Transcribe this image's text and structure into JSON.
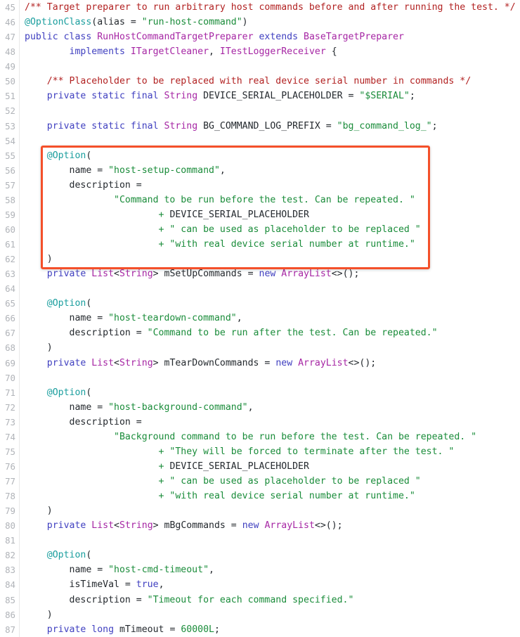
{
  "view": {
    "kind": "source-code-viewer",
    "language": "Java",
    "first_line_number": 45,
    "background_color": "#ffffff",
    "gutter_color": "#b0b3b8"
  },
  "highlight": {
    "label": "annotation-highlight-box",
    "color": "#f4502a",
    "covers_lines": "55-62"
  },
  "palette": {
    "comment": "#b22222",
    "annotation": "#1a9e9e",
    "keyword": "#4040c0",
    "type": "#a626a4",
    "string": "#1a8c3a",
    "number": "#1a8c3a",
    "plain": "#24292e"
  },
  "lines": [
    {
      "n": "45",
      "tokens": [
        {
          "t": "comment",
          "s": "/** Target preparer to run arbitrary host commands before and after running the test. */"
        }
      ]
    },
    {
      "n": "46",
      "tokens": [
        {
          "t": "anno",
          "s": "@OptionClass"
        },
        {
          "t": "plain",
          "s": "(alias = "
        },
        {
          "t": "str",
          "s": "\"run-host-command\""
        },
        {
          "t": "plain",
          "s": ")"
        }
      ]
    },
    {
      "n": "47",
      "tokens": [
        {
          "t": "kw",
          "s": "public class "
        },
        {
          "t": "type",
          "s": "RunHostCommandTargetPreparer"
        },
        {
          "t": "kw",
          "s": " extends "
        },
        {
          "t": "type",
          "s": "BaseTargetPreparer"
        }
      ]
    },
    {
      "n": "48",
      "tokens": [
        {
          "t": "kw",
          "s": "        implements "
        },
        {
          "t": "type",
          "s": "ITargetCleaner"
        },
        {
          "t": "plain",
          "s": ", "
        },
        {
          "t": "type",
          "s": "ITestLoggerReceiver"
        },
        {
          "t": "plain",
          "s": " {"
        }
      ]
    },
    {
      "n": "49",
      "tokens": []
    },
    {
      "n": "50",
      "tokens": [
        {
          "t": "comment",
          "s": "    /** Placeholder to be replaced with real device serial number in commands */"
        }
      ]
    },
    {
      "n": "51",
      "tokens": [
        {
          "t": "kw",
          "s": "    private static final "
        },
        {
          "t": "type",
          "s": "String"
        },
        {
          "t": "plain",
          "s": " DEVICE_SERIAL_PLACEHOLDER = "
        },
        {
          "t": "str",
          "s": "\"$SERIAL\""
        },
        {
          "t": "plain",
          "s": ";"
        }
      ]
    },
    {
      "n": "52",
      "tokens": []
    },
    {
      "n": "53",
      "tokens": [
        {
          "t": "kw",
          "s": "    private static final "
        },
        {
          "t": "type",
          "s": "String"
        },
        {
          "t": "plain",
          "s": " BG_COMMAND_LOG_PREFIX = "
        },
        {
          "t": "str",
          "s": "\"bg_command_log_\""
        },
        {
          "t": "plain",
          "s": ";"
        }
      ]
    },
    {
      "n": "54",
      "tokens": []
    },
    {
      "n": "55",
      "tokens": [
        {
          "t": "plain",
          "s": "    "
        },
        {
          "t": "anno",
          "s": "@Option"
        },
        {
          "t": "plain",
          "s": "("
        }
      ]
    },
    {
      "n": "56",
      "tokens": [
        {
          "t": "plain",
          "s": "        name = "
        },
        {
          "t": "str",
          "s": "\"host-setup-command\""
        },
        {
          "t": "plain",
          "s": ","
        }
      ]
    },
    {
      "n": "57",
      "tokens": [
        {
          "t": "plain",
          "s": "        description ="
        }
      ]
    },
    {
      "n": "58",
      "tokens": [
        {
          "t": "str",
          "s": "                \"Command to be run before the test. Can be repeated. \""
        }
      ]
    },
    {
      "n": "59",
      "tokens": [
        {
          "t": "str",
          "s": "                        + "
        },
        {
          "t": "plain",
          "s": "DEVICE_SERIAL_PLACEHOLDER"
        }
      ]
    },
    {
      "n": "60",
      "tokens": [
        {
          "t": "str",
          "s": "                        + \" can be used as placeholder to be replaced \""
        }
      ]
    },
    {
      "n": "61",
      "tokens": [
        {
          "t": "str",
          "s": "                        + \"with real device serial number at runtime.\""
        }
      ]
    },
    {
      "n": "62",
      "tokens": [
        {
          "t": "plain",
          "s": "    )"
        }
      ]
    },
    {
      "n": "63",
      "tokens": [
        {
          "t": "kw",
          "s": "    private "
        },
        {
          "t": "type",
          "s": "List"
        },
        {
          "t": "plain",
          "s": "<"
        },
        {
          "t": "type",
          "s": "String"
        },
        {
          "t": "plain",
          "s": "> mSetUpCommands = "
        },
        {
          "t": "kw",
          "s": "new "
        },
        {
          "t": "type",
          "s": "ArrayList"
        },
        {
          "t": "plain",
          "s": "<>();"
        }
      ]
    },
    {
      "n": "64",
      "tokens": []
    },
    {
      "n": "65",
      "tokens": [
        {
          "t": "plain",
          "s": "    "
        },
        {
          "t": "anno",
          "s": "@Option"
        },
        {
          "t": "plain",
          "s": "("
        }
      ]
    },
    {
      "n": "66",
      "tokens": [
        {
          "t": "plain",
          "s": "        name = "
        },
        {
          "t": "str",
          "s": "\"host-teardown-command\""
        },
        {
          "t": "plain",
          "s": ","
        }
      ]
    },
    {
      "n": "67",
      "tokens": [
        {
          "t": "plain",
          "s": "        description = "
        },
        {
          "t": "str",
          "s": "\"Command to be run after the test. Can be repeated.\""
        }
      ]
    },
    {
      "n": "68",
      "tokens": [
        {
          "t": "plain",
          "s": "    )"
        }
      ]
    },
    {
      "n": "69",
      "tokens": [
        {
          "t": "kw",
          "s": "    private "
        },
        {
          "t": "type",
          "s": "List"
        },
        {
          "t": "plain",
          "s": "<"
        },
        {
          "t": "type",
          "s": "String"
        },
        {
          "t": "plain",
          "s": "> mTearDownCommands = "
        },
        {
          "t": "kw",
          "s": "new "
        },
        {
          "t": "type",
          "s": "ArrayList"
        },
        {
          "t": "plain",
          "s": "<>();"
        }
      ]
    },
    {
      "n": "70",
      "tokens": []
    },
    {
      "n": "71",
      "tokens": [
        {
          "t": "plain",
          "s": "    "
        },
        {
          "t": "anno",
          "s": "@Option"
        },
        {
          "t": "plain",
          "s": "("
        }
      ]
    },
    {
      "n": "72",
      "tokens": [
        {
          "t": "plain",
          "s": "        name = "
        },
        {
          "t": "str",
          "s": "\"host-background-command\""
        },
        {
          "t": "plain",
          "s": ","
        }
      ]
    },
    {
      "n": "73",
      "tokens": [
        {
          "t": "plain",
          "s": "        description ="
        }
      ]
    },
    {
      "n": "74",
      "tokens": [
        {
          "t": "str",
          "s": "                \"Background command to be run before the test. Can be repeated. \""
        }
      ]
    },
    {
      "n": "75",
      "tokens": [
        {
          "t": "str",
          "s": "                        + \"They will be forced to terminate after the test. \""
        }
      ]
    },
    {
      "n": "76",
      "tokens": [
        {
          "t": "str",
          "s": "                        + "
        },
        {
          "t": "plain",
          "s": "DEVICE_SERIAL_PLACEHOLDER"
        }
      ]
    },
    {
      "n": "77",
      "tokens": [
        {
          "t": "str",
          "s": "                        + \" can be used as placeholder to be replaced \""
        }
      ]
    },
    {
      "n": "78",
      "tokens": [
        {
          "t": "str",
          "s": "                        + \"with real device serial number at runtime.\""
        }
      ]
    },
    {
      "n": "79",
      "tokens": [
        {
          "t": "plain",
          "s": "    )"
        }
      ]
    },
    {
      "n": "80",
      "tokens": [
        {
          "t": "kw",
          "s": "    private "
        },
        {
          "t": "type",
          "s": "List"
        },
        {
          "t": "plain",
          "s": "<"
        },
        {
          "t": "type",
          "s": "String"
        },
        {
          "t": "plain",
          "s": "> mBgCommands = "
        },
        {
          "t": "kw",
          "s": "new "
        },
        {
          "t": "type",
          "s": "ArrayList"
        },
        {
          "t": "plain",
          "s": "<>();"
        }
      ]
    },
    {
      "n": "81",
      "tokens": []
    },
    {
      "n": "82",
      "tokens": [
        {
          "t": "plain",
          "s": "    "
        },
        {
          "t": "anno",
          "s": "@Option"
        },
        {
          "t": "plain",
          "s": "("
        }
      ]
    },
    {
      "n": "83",
      "tokens": [
        {
          "t": "plain",
          "s": "        name = "
        },
        {
          "t": "str",
          "s": "\"host-cmd-timeout\""
        },
        {
          "t": "plain",
          "s": ","
        }
      ]
    },
    {
      "n": "84",
      "tokens": [
        {
          "t": "plain",
          "s": "        isTimeVal = "
        },
        {
          "t": "kw",
          "s": "true"
        },
        {
          "t": "plain",
          "s": ","
        }
      ]
    },
    {
      "n": "85",
      "tokens": [
        {
          "t": "plain",
          "s": "        description = "
        },
        {
          "t": "str",
          "s": "\"Timeout for each command specified.\""
        }
      ]
    },
    {
      "n": "86",
      "tokens": [
        {
          "t": "plain",
          "s": "    )"
        }
      ]
    },
    {
      "n": "87",
      "tokens": [
        {
          "t": "kw",
          "s": "    private long "
        },
        {
          "t": "plain",
          "s": "mTimeout = "
        },
        {
          "t": "num",
          "s": "60000L"
        },
        {
          "t": "plain",
          "s": ";"
        }
      ]
    }
  ]
}
